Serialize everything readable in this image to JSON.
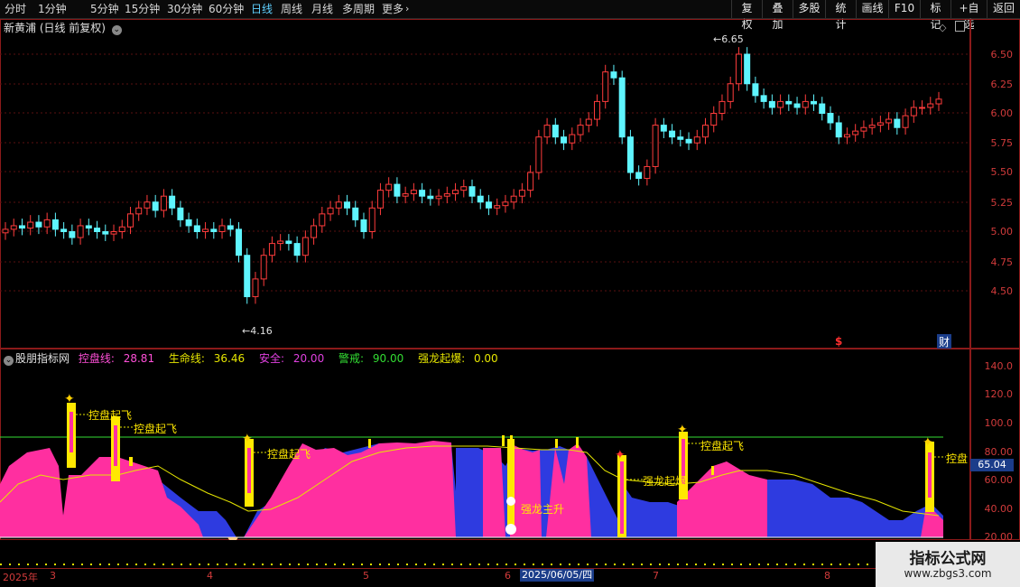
{
  "toolbar": {
    "periods": [
      {
        "label": "分时",
        "active": false
      },
      {
        "label": "1分钟",
        "active": false
      },
      {
        "label": "5分钟",
        "active": false
      },
      {
        "label": "15分钟",
        "active": false
      },
      {
        "label": "30分钟",
        "active": false
      },
      {
        "label": "60分钟",
        "active": false
      },
      {
        "label": "日线",
        "active": true
      },
      {
        "label": "周线",
        "active": false
      },
      {
        "label": "月线",
        "active": false
      },
      {
        "label": "多周期",
        "active": false
      },
      {
        "label": "更多",
        "active": false
      }
    ],
    "right_buttons": [
      "复权",
      "叠加",
      "多股",
      "统计",
      "画线",
      "F10",
      "标记",
      "+自选",
      "返回"
    ]
  },
  "price_pane": {
    "title": "新黄浦 (日线 前复权)",
    "y_ticks": [
      "6.50",
      "6.25",
      "6.00",
      "5.75",
      "5.50",
      "5.25",
      "5.00",
      "4.75",
      "4.50"
    ],
    "high_label": "6.65",
    "low_label": "4.16",
    "marker_dollar": "$",
    "marker_cai": "财"
  },
  "indicator_pane": {
    "name": "股朋指标网",
    "items": [
      {
        "label": "控盘线:",
        "value": "28.81",
        "color": "#ff4fd8"
      },
      {
        "label": "生命线:",
        "value": "36.46",
        "color": "#e6e600"
      },
      {
        "label": "安全:",
        "value": "20.00",
        "color": "#e040e0"
      },
      {
        "label": "警戒:",
        "value": "90.00",
        "color": "#33dd33"
      },
      {
        "label": "强龙起爆:",
        "value": "0.00",
        "color": "#e6e600"
      }
    ],
    "y_ticks": [
      "140.0",
      "120.0",
      "100.0",
      "80.00",
      "60.00",
      "40.00",
      "20.00"
    ],
    "current_value": "65.04",
    "annotations": [
      "控盘起飞",
      "控盘起飞",
      "控盘起飞",
      "控盘起飞",
      "强龙起爆",
      "控盘起飞",
      "控盘",
      "强龙主升"
    ]
  },
  "date_axis": {
    "year": "2025年",
    "months": [
      "3",
      "4",
      "5",
      "6",
      "7",
      "8"
    ],
    "cursor_date": "2025/06/05/四"
  },
  "watermark": {
    "line1": "指标公式网",
    "line2": "www.zbgs3.com"
  }
}
